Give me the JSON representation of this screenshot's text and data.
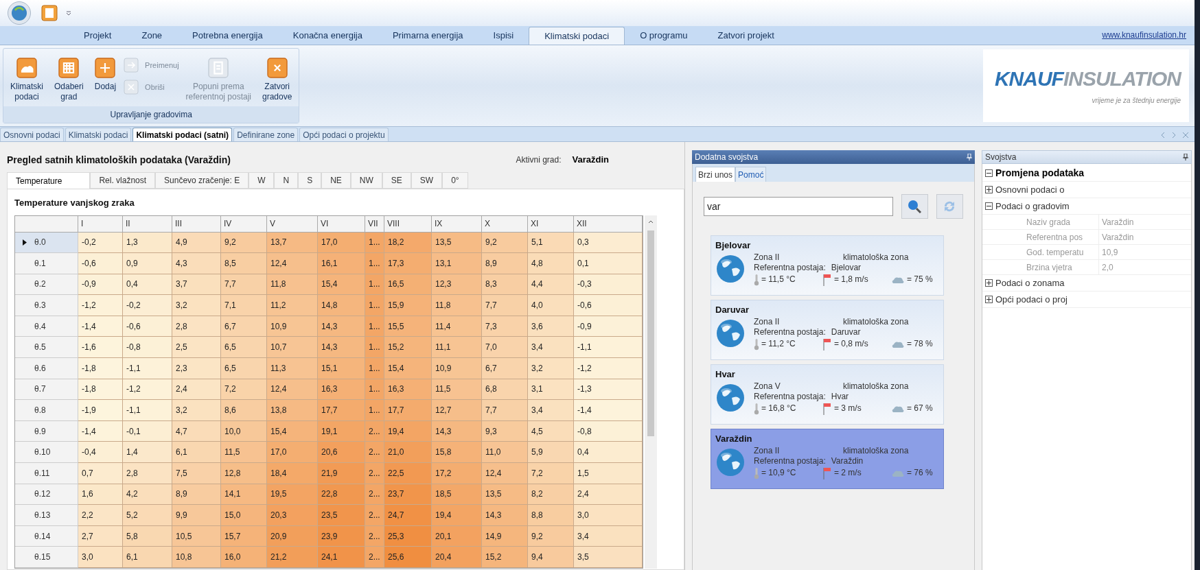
{
  "ribbon_tabs": [
    {
      "label": "Projekt",
      "selected": false
    },
    {
      "label": "Zone",
      "selected": false
    },
    {
      "label": "Potrebna energija",
      "selected": false
    },
    {
      "label": "Konačna energija",
      "selected": false
    },
    {
      "label": "Primarna energija",
      "selected": false
    },
    {
      "label": "Ispisi",
      "selected": false
    },
    {
      "label": "Klimatski podaci",
      "selected": true
    },
    {
      "label": "O programu",
      "selected": false
    },
    {
      "label": "Zatvori projekt",
      "selected": false
    }
  ],
  "website_link": "www.knaufinsulation.hr",
  "ribbon_buttons": [
    {
      "kind": "large",
      "lines": [
        "Klimatski",
        "podaci"
      ],
      "disabled": false
    },
    {
      "kind": "large",
      "lines": [
        "Odaberi",
        "grad"
      ],
      "disabled": false
    },
    {
      "kind": "large",
      "lines": [
        "Dodaj"
      ],
      "disabled": false
    },
    {
      "kind": "small",
      "lines": [
        "Preimenuj"
      ],
      "disabled": true
    },
    {
      "kind": "small",
      "lines": [
        "Obriši"
      ],
      "disabled": true
    },
    {
      "kind": "large",
      "lines": [
        "Popuni prema",
        "referentnoj postaji"
      ],
      "disabled": true
    },
    {
      "kind": "large",
      "lines": [
        "Zatvori",
        "gradove"
      ],
      "disabled": false
    }
  ],
  "ribbon_group_label": "Upravljanje gradovima",
  "logo": {
    "brand": "KNAUF",
    "brand2": "INSULATION",
    "tagline": "vrijeme je za štednju energije"
  },
  "document_tabs": [
    {
      "label": "Osnovni podaci",
      "selected": false
    },
    {
      "label": "Klimatski podaci",
      "selected": false
    },
    {
      "label": "Klimatski podaci (satni)",
      "selected": true
    },
    {
      "label": "Definirane zone",
      "selected": false
    },
    {
      "label": "Opći podaci o projektu",
      "selected": false
    }
  ],
  "main": {
    "title": "Pregled satnih klimatoloških podataka (Varaždin)",
    "active_city_label": "Aktivni grad:",
    "active_city": "Varaždin",
    "subtabs": [
      {
        "label": "Temperature",
        "selected": true
      },
      {
        "label": "Rel. vlažnost",
        "selected": false
      },
      {
        "label": "Sunčevo zračenje: E",
        "selected": false
      },
      {
        "label": "W",
        "selected": false
      },
      {
        "label": "N",
        "selected": false
      },
      {
        "label": "S",
        "selected": false
      },
      {
        "label": "NE",
        "selected": false
      },
      {
        "label": "NW",
        "selected": false
      },
      {
        "label": "SE",
        "selected": false
      },
      {
        "label": "SW",
        "selected": false
      },
      {
        "label": "0°",
        "selected": false
      }
    ],
    "table_title": "Temperature vanjskog zraka",
    "table": {
      "columns": [
        "I",
        "II",
        "III",
        "IV",
        "V",
        "VI",
        "VII",
        "VIII",
        "IX",
        "X",
        "XI",
        "XII"
      ],
      "rows": [
        {
          "label": "θ.0",
          "selected": true,
          "cells": [
            "-0,2",
            "1,3",
            "4,9",
            "9,2",
            "13,7",
            "17,0",
            "1...",
            "18,2",
            "13,5",
            "9,2",
            "5,1",
            "0,3"
          ]
        },
        {
          "label": "θ.1",
          "selected": false,
          "cells": [
            "-0,6",
            "0,9",
            "4,3",
            "8,5",
            "12,4",
            "16,1",
            "1...",
            "17,3",
            "13,1",
            "8,9",
            "4,8",
            "0,1"
          ]
        },
        {
          "label": "θ.2",
          "selected": false,
          "cells": [
            "-0,9",
            "0,4",
            "3,7",
            "7,7",
            "11,8",
            "15,4",
            "1...",
            "16,5",
            "12,3",
            "8,3",
            "4,4",
            "-0,3"
          ]
        },
        {
          "label": "θ.3",
          "selected": false,
          "cells": [
            "-1,2",
            "-0,2",
            "3,2",
            "7,1",
            "11,2",
            "14,8",
            "1...",
            "15,9",
            "11,8",
            "7,7",
            "4,0",
            "-0,6"
          ]
        },
        {
          "label": "θ.4",
          "selected": false,
          "cells": [
            "-1,4",
            "-0,6",
            "2,8",
            "6,7",
            "10,9",
            "14,3",
            "1...",
            "15,5",
            "11,4",
            "7,3",
            "3,6",
            "-0,9"
          ]
        },
        {
          "label": "θ.5",
          "selected": false,
          "cells": [
            "-1,6",
            "-0,8",
            "2,5",
            "6,5",
            "10,7",
            "14,3",
            "1...",
            "15,2",
            "11,1",
            "7,0",
            "3,4",
            "-1,1"
          ]
        },
        {
          "label": "θ.6",
          "selected": false,
          "cells": [
            "-1,8",
            "-1,1",
            "2,3",
            "6,5",
            "11,3",
            "15,1",
            "1...",
            "15,4",
            "10,9",
            "6,7",
            "3,2",
            "-1,2"
          ]
        },
        {
          "label": "θ.7",
          "selected": false,
          "cells": [
            "-1,8",
            "-1,2",
            "2,4",
            "7,2",
            "12,4",
            "16,3",
            "1...",
            "16,3",
            "11,5",
            "6,8",
            "3,1",
            "-1,3"
          ]
        },
        {
          "label": "θ.8",
          "selected": false,
          "cells": [
            "-1,9",
            "-1,1",
            "3,2",
            "8,6",
            "13,8",
            "17,7",
            "1...",
            "17,7",
            "12,7",
            "7,7",
            "3,4",
            "-1,4"
          ]
        },
        {
          "label": "θ.9",
          "selected": false,
          "cells": [
            "-1,4",
            "-0,1",
            "4,7",
            "10,0",
            "15,4",
            "19,1",
            "2...",
            "19,4",
            "14,3",
            "9,3",
            "4,5",
            "-0,8"
          ]
        },
        {
          "label": "θ.10",
          "selected": false,
          "cells": [
            "-0,4",
            "1,4",
            "6,1",
            "11,5",
            "17,0",
            "20,6",
            "2...",
            "21,0",
            "15,8",
            "11,0",
            "5,9",
            "0,4"
          ]
        },
        {
          "label": "θ.11",
          "selected": false,
          "cells": [
            "0,7",
            "2,8",
            "7,5",
            "12,8",
            "18,4",
            "21,9",
            "2...",
            "22,5",
            "17,2",
            "12,4",
            "7,2",
            "1,5"
          ]
        },
        {
          "label": "θ.12",
          "selected": false,
          "cells": [
            "1,6",
            "4,2",
            "8,9",
            "14,1",
            "19,5",
            "22,8",
            "2...",
            "23,7",
            "18,5",
            "13,5",
            "8,2",
            "2,4"
          ]
        },
        {
          "label": "θ.13",
          "selected": false,
          "cells": [
            "2,2",
            "5,2",
            "9,9",
            "15,0",
            "20,3",
            "23,5",
            "2...",
            "24,7",
            "19,4",
            "14,3",
            "8,8",
            "3,0"
          ]
        },
        {
          "label": "θ.14",
          "selected": false,
          "cells": [
            "2,7",
            "5,8",
            "10,5",
            "15,7",
            "20,9",
            "23,9",
            "2...",
            "25,3",
            "20,1",
            "14,9",
            "9,2",
            "3,4"
          ]
        },
        {
          "label": "θ.15",
          "selected": false,
          "cells": [
            "3,0",
            "6,1",
            "10,8",
            "16,0",
            "21,2",
            "24,1",
            "2...",
            "25,6",
            "20,4",
            "15,2",
            "9,4",
            "3,5"
          ]
        }
      ]
    }
  },
  "extra_panel": {
    "title": "Dodatna svojstva",
    "tabs": [
      {
        "label": "Brzi unos",
        "selected": true
      },
      {
        "label": "Pomoć",
        "selected": false
      }
    ],
    "search_value": "var",
    "cities": [
      {
        "name": "Bjelovar",
        "zone": "Zona II",
        "zone_label": "klimatološka zona",
        "station_label": "Referentna postaja:",
        "station": "Bjelovar",
        "temperature": "= 11,5 °C",
        "wind": "= 1,8 m/s",
        "humidity": "= 75 %",
        "selected": false
      },
      {
        "name": "Daruvar",
        "zone": "Zona II",
        "zone_label": "klimatološka zona",
        "station_label": "Referentna postaja:",
        "station": "Daruvar",
        "temperature": "= 11,2 °C",
        "wind": "= 0,8 m/s",
        "humidity": "= 78 %",
        "selected": false
      },
      {
        "name": "Hvar",
        "zone": "Zona V",
        "zone_label": "klimatološka zona",
        "station_label": "Referentna postaja:",
        "station": "Hvar",
        "temperature": "= 16,8 °C",
        "wind": "= 3 m/s",
        "humidity": "= 67 %",
        "selected": false
      },
      {
        "name": "Varaždin",
        "zone": "Zona II",
        "zone_label": "klimatološka zona",
        "station_label": "Referentna postaja:",
        "station": "Varaždin",
        "temperature": "= 10,9 °C",
        "wind": "= 2 m/s",
        "humidity": "= 76 %",
        "selected": true
      }
    ]
  },
  "properties_panel": {
    "title": "Svojstva",
    "tree": [
      {
        "label": "Promjena podataka",
        "expanded": true,
        "children": [
          {
            "label": "Osnovni podaci o",
            "expanded": false
          },
          {
            "label": "Podaci o gradovim",
            "expanded": true,
            "children": [
              {
                "label": "Naziv grada",
                "value": "Varaždin"
              },
              {
                "label": "Referentna pos",
                "value": "Varaždin"
              },
              {
                "label": "God. temperatu",
                "value": "10,9"
              },
              {
                "label": "Brzina vjetra",
                "value": "2,0"
              }
            ]
          },
          {
            "label": "Podaci o zonama",
            "expanded": false
          },
          {
            "label": "Opći podaci o proj",
            "expanded": false
          }
        ]
      }
    ]
  }
}
